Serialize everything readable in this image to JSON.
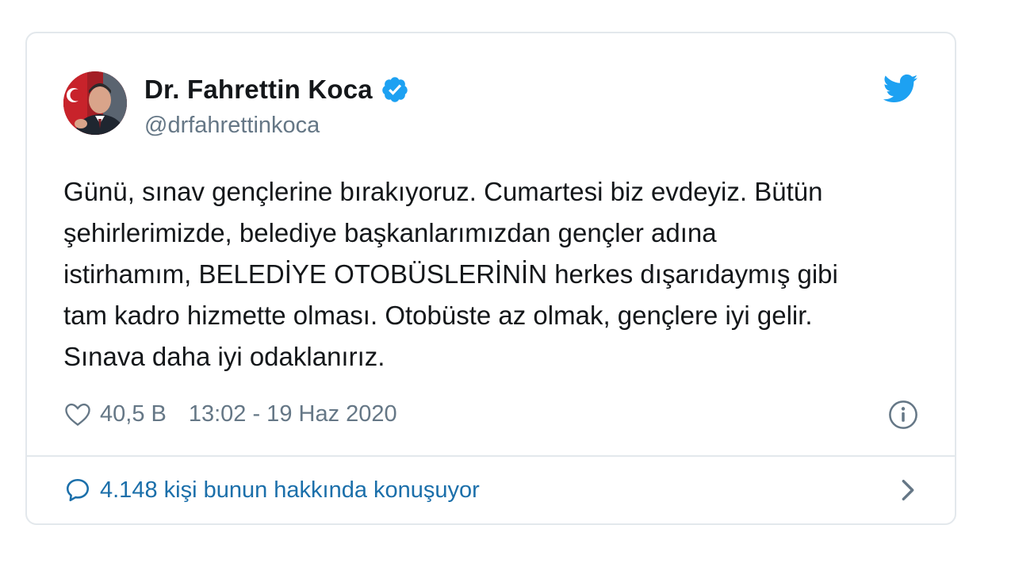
{
  "tweet": {
    "author_name": "Dr. Fahrettin Koca",
    "author_handle": "@drfahrettinkoca",
    "text": "Günü, sınav gençlerine bırakıyoruz. Cumartesi biz evdeyiz. Bütün\nşehirlerimizde, belediye başkanlarımızdan gençler adına\nistirhamım, BELEDİYE OTOBÜSLERİNİN herkes dışarıdaymış gibi\ntam kadro hizmette olması. Otobüste az olmak, gençlere iyi gelir.\nSınava daha iyi odaklanırız.",
    "like_count": "40,5 B",
    "timestamp": "13:02 - 19 Haz 2020",
    "conversation_label": "4.148 kişi bunun hakkında konuşuyor"
  },
  "icons": {
    "verified": "verified-badge-icon",
    "brand": "twitter-bird-icon",
    "like": "heart-icon",
    "info": "info-icon",
    "reply": "speech-bubble-icon",
    "chevron": "chevron-right-icon"
  },
  "colors": {
    "brand_blue": "#1da1f2",
    "link_blue": "#1b6faa",
    "text_primary": "#14171a",
    "text_secondary": "#657786",
    "border": "#e3e8ec"
  }
}
